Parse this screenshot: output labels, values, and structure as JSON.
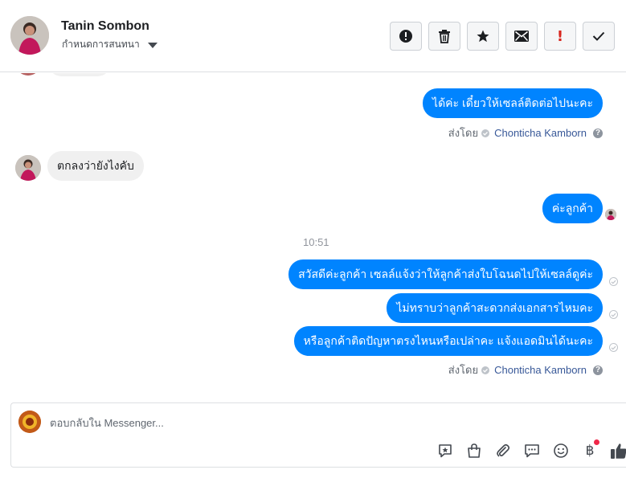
{
  "header": {
    "contact_name": "Tanin Sombon",
    "assign_label": "กำหนดการสนทนา",
    "actions": [
      {
        "name": "mark-spam-button",
        "icon": "alert-circle-icon"
      },
      {
        "name": "delete-button",
        "icon": "trash-icon"
      },
      {
        "name": "star-button",
        "icon": "star-icon"
      },
      {
        "name": "mark-unread-button",
        "icon": "envelope-icon"
      },
      {
        "name": "follow-up-button",
        "icon": "exclamation-icon"
      },
      {
        "name": "mark-done-button",
        "icon": "check-icon"
      }
    ]
  },
  "messages": {
    "m1": "ได้ค่ะ เดี๋ยวให้เซลล์ติดต่อไปนะคะ",
    "sent_by_1": {
      "prefix": "ส่งโดย",
      "agent": "Chonticha Kamborn"
    },
    "m2": "ตกลงว่ายังไงคับ",
    "m3": "ค่ะลูกค้า",
    "time": "10:51",
    "m4": "สวัสดีค่ะลูกค้า เซลล์แจ้งว่าให้ลูกค้าส่งใบโฉนดไปให้เซลล์ดูค่ะ",
    "m5": "ไม่ทราบว่าลูกค้าสะดวกส่งเอกสารไหมคะ",
    "m6": "หรือลูกค้าติดปัญหาตรงไหนหรือเปล่าคะ แจ้งแอดมินได้นะคะ",
    "sent_by_2": {
      "prefix": "ส่งโดย",
      "agent": "Chonticha Kamborn"
    },
    "help_glyph": "?"
  },
  "composer": {
    "placeholder": "ตอบกลับใน Messenger...",
    "tools": [
      "saved-reply-icon",
      "shop-bag-icon",
      "attachment-icon",
      "chat-bubble-icon",
      "emoji-icon",
      "baht-icon",
      "thumbs-up-icon"
    ],
    "baht_glyph": "฿"
  },
  "colors": {
    "outgoing_bubble": "#0084ff",
    "incoming_bubble": "#f0f0f0",
    "agent_link": "#385898",
    "follow_up_red": "#d8251d"
  }
}
